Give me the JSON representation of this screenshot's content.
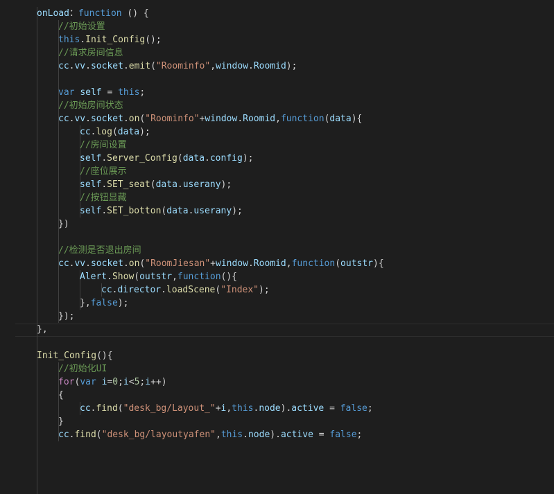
{
  "editor": {
    "theme": {
      "background": "#1e1e1e",
      "foreground": "#d4d4d4",
      "keyword": "#569cd6",
      "string": "#ce9178",
      "comment": "#6a9955",
      "function": "#dcdcaa",
      "property": "#9cdcfe",
      "number": "#b5cea8",
      "control": "#c586c0"
    },
    "lines": [
      {
        "indent": 1,
        "tokens": [
          [
            "pr",
            "onLoad"
          ],
          [
            "",
            "："
          ],
          [
            "kw",
            "function"
          ],
          [
            "",
            " () {"
          ]
        ]
      },
      {
        "indent": 2,
        "tokens": [
          [
            "cm",
            "//初始设置"
          ]
        ]
      },
      {
        "indent": 2,
        "tokens": [
          [
            "kw",
            "this"
          ],
          [
            "",
            "."
          ],
          [
            "fn",
            "Init_Config"
          ],
          [
            "",
            "();"
          ]
        ]
      },
      {
        "indent": 2,
        "tokens": [
          [
            "cm",
            "//请求房间信息"
          ]
        ]
      },
      {
        "indent": 2,
        "tokens": [
          [
            "pr",
            "cc"
          ],
          [
            "",
            "."
          ],
          [
            "pr",
            "vv"
          ],
          [
            "",
            "."
          ],
          [
            "pr",
            "socket"
          ],
          [
            "",
            "."
          ],
          [
            "fn",
            "emit"
          ],
          [
            "",
            "("
          ],
          [
            "str",
            "\"Roominfo\""
          ],
          [
            "",
            ","
          ],
          [
            "pr",
            "window"
          ],
          [
            "",
            "."
          ],
          [
            "pr",
            "Roomid"
          ],
          [
            "",
            ");"
          ]
        ]
      },
      {
        "indent": 0,
        "tokens": []
      },
      {
        "indent": 2,
        "tokens": [
          [
            "kw",
            "var"
          ],
          [
            "",
            " "
          ],
          [
            "pr",
            "self"
          ],
          [
            "",
            " = "
          ],
          [
            "kw",
            "this"
          ],
          [
            "",
            ";"
          ]
        ]
      },
      {
        "indent": 2,
        "tokens": [
          [
            "cm",
            "//初始房间状态"
          ]
        ]
      },
      {
        "indent": 2,
        "tokens": [
          [
            "pr",
            "cc"
          ],
          [
            "",
            "."
          ],
          [
            "pr",
            "vv"
          ],
          [
            "",
            "."
          ],
          [
            "pr",
            "socket"
          ],
          [
            "",
            "."
          ],
          [
            "fn",
            "on"
          ],
          [
            "",
            "("
          ],
          [
            "str",
            "\"Roominfo\""
          ],
          [
            "",
            "+"
          ],
          [
            "pr",
            "window"
          ],
          [
            "",
            "."
          ],
          [
            "pr",
            "Roomid"
          ],
          [
            "",
            ","
          ],
          [
            "kw",
            "function"
          ],
          [
            "",
            "("
          ],
          [
            "pr",
            "data"
          ],
          [
            "",
            "){"
          ]
        ]
      },
      {
        "indent": 3,
        "tokens": [
          [
            "pr",
            "cc"
          ],
          [
            "",
            "."
          ],
          [
            "fn",
            "log"
          ],
          [
            "",
            "("
          ],
          [
            "pr",
            "data"
          ],
          [
            "",
            ");"
          ]
        ]
      },
      {
        "indent": 3,
        "tokens": [
          [
            "cm",
            "//房间设置"
          ]
        ]
      },
      {
        "indent": 3,
        "tokens": [
          [
            "pr",
            "self"
          ],
          [
            "",
            "."
          ],
          [
            "fn",
            "Server_Config"
          ],
          [
            "",
            "("
          ],
          [
            "pr",
            "data"
          ],
          [
            "",
            "."
          ],
          [
            "pr",
            "config"
          ],
          [
            "",
            ");"
          ]
        ]
      },
      {
        "indent": 3,
        "tokens": [
          [
            "cm",
            "//座位展示"
          ]
        ]
      },
      {
        "indent": 3,
        "tokens": [
          [
            "pr",
            "self"
          ],
          [
            "",
            "."
          ],
          [
            "fn",
            "SET_seat"
          ],
          [
            "",
            "("
          ],
          [
            "pr",
            "data"
          ],
          [
            "",
            "."
          ],
          [
            "pr",
            "userany"
          ],
          [
            "",
            ");"
          ]
        ]
      },
      {
        "indent": 3,
        "tokens": [
          [
            "cm",
            "//按钮显藏"
          ]
        ]
      },
      {
        "indent": 3,
        "tokens": [
          [
            "pr",
            "self"
          ],
          [
            "",
            "."
          ],
          [
            "fn",
            "SET_botton"
          ],
          [
            "",
            "("
          ],
          [
            "pr",
            "data"
          ],
          [
            "",
            "."
          ],
          [
            "pr",
            "userany"
          ],
          [
            "",
            ");"
          ]
        ]
      },
      {
        "indent": 2,
        "tokens": [
          [
            "",
            "})"
          ]
        ]
      },
      {
        "indent": 0,
        "tokens": []
      },
      {
        "indent": 2,
        "tokens": [
          [
            "cm",
            "//检测是否退出房间"
          ]
        ]
      },
      {
        "indent": 2,
        "tokens": [
          [
            "pr",
            "cc"
          ],
          [
            "",
            "."
          ],
          [
            "pr",
            "vv"
          ],
          [
            "",
            "."
          ],
          [
            "pr",
            "socket"
          ],
          [
            "",
            "."
          ],
          [
            "fn",
            "on"
          ],
          [
            "",
            "("
          ],
          [
            "str",
            "\"RoomJiesan\""
          ],
          [
            "",
            "+"
          ],
          [
            "pr",
            "window"
          ],
          [
            "",
            "."
          ],
          [
            "pr",
            "Roomid"
          ],
          [
            "",
            ","
          ],
          [
            "kw",
            "function"
          ],
          [
            "",
            "("
          ],
          [
            "pr",
            "outstr"
          ],
          [
            "",
            "){"
          ]
        ]
      },
      {
        "indent": 3,
        "tokens": [
          [
            "pr",
            "Alert"
          ],
          [
            "",
            "."
          ],
          [
            "fn",
            "Show"
          ],
          [
            "",
            "("
          ],
          [
            "pr",
            "outstr"
          ],
          [
            "",
            ","
          ],
          [
            "kw",
            "function"
          ],
          [
            "",
            "(){"
          ]
        ]
      },
      {
        "indent": 4,
        "tokens": [
          [
            "pr",
            "cc"
          ],
          [
            "",
            "."
          ],
          [
            "pr",
            "director"
          ],
          [
            "",
            "."
          ],
          [
            "fn",
            "loadScene"
          ],
          [
            "",
            "("
          ],
          [
            "str",
            "\"Index\""
          ],
          [
            "",
            ");"
          ]
        ]
      },
      {
        "indent": 3,
        "tokens": [
          [
            "",
            "},"
          ],
          [
            "kw",
            "false"
          ],
          [
            "",
            ");"
          ]
        ]
      },
      {
        "indent": 2,
        "tokens": [
          [
            "",
            "});"
          ]
        ]
      },
      {
        "indent": 1,
        "tokens": [
          [
            "",
            "},"
          ]
        ]
      },
      {
        "indent": 0,
        "tokens": []
      },
      {
        "indent": 1,
        "tokens": [
          [
            "fn",
            "Init_Config"
          ],
          [
            "",
            "(){"
          ]
        ]
      },
      {
        "indent": 2,
        "tokens": [
          [
            "cm",
            "//初始化UI"
          ]
        ]
      },
      {
        "indent": 2,
        "tokens": [
          [
            "ctl",
            "for"
          ],
          [
            "",
            "("
          ],
          [
            "kw",
            "var"
          ],
          [
            "",
            " "
          ],
          [
            "pr",
            "i"
          ],
          [
            "",
            "="
          ],
          [
            "num",
            "0"
          ],
          [
            "",
            ";"
          ],
          [
            "pr",
            "i"
          ],
          [
            "",
            "<"
          ],
          [
            "num",
            "5"
          ],
          [
            "",
            ";"
          ],
          [
            "pr",
            "i"
          ],
          [
            "",
            "++)"
          ]
        ]
      },
      {
        "indent": 2,
        "tokens": [
          [
            "",
            "{"
          ]
        ]
      },
      {
        "indent": 3,
        "tokens": [
          [
            "pr",
            "cc"
          ],
          [
            "",
            "."
          ],
          [
            "fn",
            "find"
          ],
          [
            "",
            "("
          ],
          [
            "str",
            "\"desk_bg/Layout_\""
          ],
          [
            "",
            "+"
          ],
          [
            "pr",
            "i"
          ],
          [
            "",
            ","
          ],
          [
            "kw",
            "this"
          ],
          [
            "",
            "."
          ],
          [
            "pr",
            "node"
          ],
          [
            "",
            ")."
          ],
          [
            "pr",
            "active"
          ],
          [
            "",
            " = "
          ],
          [
            "kw",
            "false"
          ],
          [
            "",
            ";"
          ]
        ]
      },
      {
        "indent": 2,
        "tokens": [
          [
            "",
            "}"
          ]
        ]
      },
      {
        "indent": 2,
        "tokens": [
          [
            "pr",
            "cc"
          ],
          [
            "",
            "."
          ],
          [
            "fn",
            "find"
          ],
          [
            "",
            "("
          ],
          [
            "str",
            "\"desk_bg/layoutyafen\""
          ],
          [
            "",
            ","
          ],
          [
            "kw",
            "this"
          ],
          [
            "",
            "."
          ],
          [
            "pr",
            "node"
          ],
          [
            "",
            ")."
          ],
          [
            "pr",
            "active"
          ],
          [
            "",
            " = "
          ],
          [
            "kw",
            "false"
          ],
          [
            "",
            ";"
          ]
        ]
      }
    ]
  }
}
